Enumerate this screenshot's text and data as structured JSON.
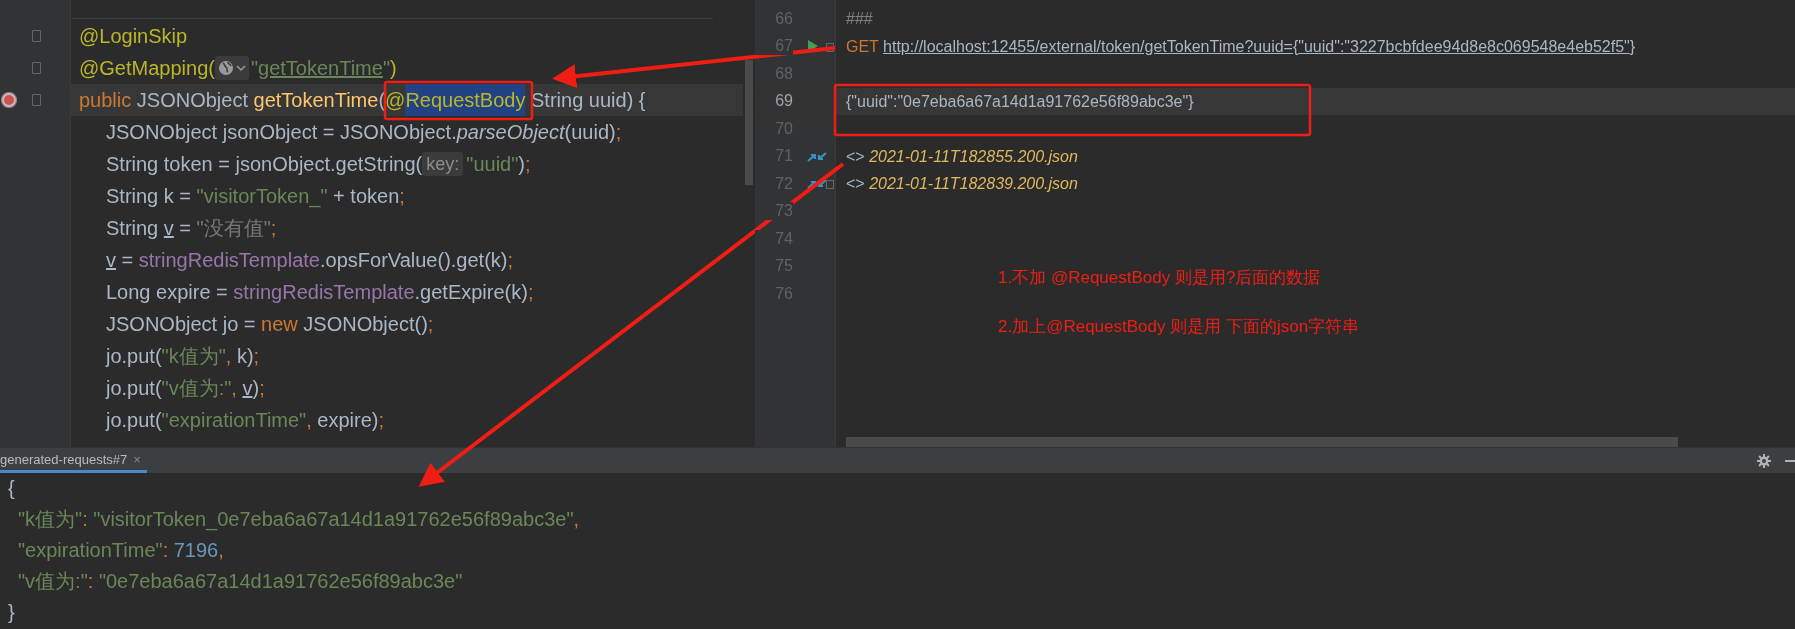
{
  "left_editor": {
    "lines": [
      {
        "fold": true,
        "override": false,
        "current": false,
        "indent": false,
        "tokens": [
          {
            "kind": "annotation",
            "text": "@LoginSkip"
          }
        ]
      },
      {
        "fold": true,
        "override": false,
        "current": false,
        "indent": false,
        "tokens": [
          {
            "kind": "annotation",
            "text": "@GetMapping("
          },
          {
            "kind": "globe-hint"
          },
          {
            "kind": "string",
            "text": "\""
          },
          {
            "kind": "url",
            "text": "getTokenTime"
          },
          {
            "kind": "string",
            "text": "\""
          },
          {
            "kind": "annotation",
            "text": ")"
          }
        ]
      },
      {
        "fold": true,
        "override": true,
        "current": true,
        "indent": false,
        "tokens": [
          {
            "kind": "keyword",
            "text": "public "
          },
          {
            "kind": "plain",
            "text": "JSONObject "
          },
          {
            "kind": "declaration",
            "text": "getTokenTime"
          },
          {
            "kind": "plain",
            "text": "("
          },
          {
            "kind": "annotation",
            "text": "@"
          },
          {
            "kind": "selected",
            "text": "RequestBody"
          },
          {
            "kind": "plain",
            "text": " String uuid) {"
          }
        ]
      },
      {
        "fold": false,
        "override": false,
        "current": false,
        "indent": true,
        "tokens": [
          {
            "kind": "plain",
            "text": "JSONObject jsonObject = JSONObject."
          },
          {
            "kind": "method",
            "text": "parseObject"
          },
          {
            "kind": "plain",
            "text": "(uuid)"
          },
          {
            "kind": "punct",
            "text": ";"
          }
        ]
      },
      {
        "fold": false,
        "override": false,
        "current": false,
        "indent": true,
        "tokens": [
          {
            "kind": "plain",
            "text": "String token = jsonObject.getString("
          },
          {
            "kind": "hint",
            "text": "key:"
          },
          {
            "kind": "string",
            "text": "\"uuid\""
          },
          {
            "kind": "plain",
            "text": ")"
          },
          {
            "kind": "punct",
            "text": ";"
          }
        ]
      },
      {
        "fold": false,
        "override": false,
        "current": false,
        "indent": true,
        "tokens": [
          {
            "kind": "plain",
            "text": "String k = "
          },
          {
            "kind": "string",
            "text": "\"visitorToken_\""
          },
          {
            "kind": "plain",
            "text": " + token"
          },
          {
            "kind": "punct",
            "text": ";"
          }
        ]
      },
      {
        "fold": false,
        "override": false,
        "current": false,
        "indent": true,
        "tokens": [
          {
            "kind": "plain",
            "text": "String "
          },
          {
            "kind": "var",
            "text": "v"
          },
          {
            "kind": "plain",
            "text": " = "
          },
          {
            "kind": "unused",
            "text": "\"没有值\""
          },
          {
            "kind": "punct",
            "text": ";"
          }
        ]
      },
      {
        "fold": false,
        "override": false,
        "current": false,
        "indent": true,
        "tokens": [
          {
            "kind": "var",
            "text": "v"
          },
          {
            "kind": "plain",
            "text": " = "
          },
          {
            "kind": "field",
            "text": "stringRedisTemplate"
          },
          {
            "kind": "plain",
            "text": ".opsForValue().get(k)"
          },
          {
            "kind": "punct",
            "text": ";"
          }
        ]
      },
      {
        "fold": false,
        "override": false,
        "current": false,
        "indent": true,
        "tokens": [
          {
            "kind": "plain",
            "text": "Long expire = "
          },
          {
            "kind": "field",
            "text": "stringRedisTemplate"
          },
          {
            "kind": "plain",
            "text": ".getExpire(k)"
          },
          {
            "kind": "punct",
            "text": ";"
          }
        ]
      },
      {
        "fold": false,
        "override": false,
        "current": false,
        "indent": true,
        "tokens": [
          {
            "kind": "plain",
            "text": "JSONObject jo = "
          },
          {
            "kind": "keyword",
            "text": "new"
          },
          {
            "kind": "plain",
            "text": " JSONObject()"
          },
          {
            "kind": "punct",
            "text": ";"
          }
        ]
      },
      {
        "fold": false,
        "override": false,
        "current": false,
        "indent": true,
        "tokens": [
          {
            "kind": "plain",
            "text": "jo.put("
          },
          {
            "kind": "string",
            "text": "\"k值为\""
          },
          {
            "kind": "punct",
            "text": ","
          },
          {
            "kind": "plain",
            "text": " k)"
          },
          {
            "kind": "punct",
            "text": ";"
          }
        ]
      },
      {
        "fold": false,
        "override": false,
        "current": false,
        "indent": true,
        "tokens": [
          {
            "kind": "plain",
            "text": "jo.put("
          },
          {
            "kind": "string",
            "text": "\"v值为:\""
          },
          {
            "kind": "punct",
            "text": ", "
          },
          {
            "kind": "var",
            "text": "v"
          },
          {
            "kind": "plain",
            "text": ")"
          },
          {
            "kind": "punct",
            "text": ";"
          }
        ]
      },
      {
        "fold": false,
        "override": false,
        "current": false,
        "indent": true,
        "tokens": [
          {
            "kind": "plain",
            "text": "jo.put("
          },
          {
            "kind": "string",
            "text": "\"expirationTime\""
          },
          {
            "kind": "punct",
            "text": ","
          },
          {
            "kind": "plain",
            "text": " expire)"
          },
          {
            "kind": "punct",
            "text": ";"
          }
        ]
      }
    ]
  },
  "right_editor": {
    "lines": [
      {
        "number": "66",
        "kind": "plain",
        "fold": false,
        "current": false,
        "tokens": [
          {
            "kind": "comment",
            "text": "###"
          }
        ]
      },
      {
        "number": "67",
        "kind": "run",
        "fold": true,
        "current": false,
        "tokens": [
          {
            "kind": "keyword",
            "text": "GET "
          },
          {
            "kind": "link",
            "text": "http://localhost:12455/external/token/getTokenTime?uuid={\"uuid\":\"3227bcbfdee94d8e8c069548e4eb52f5\"}"
          }
        ]
      },
      {
        "number": "68",
        "kind": "plain",
        "fold": false,
        "current": false
      },
      {
        "number": "69",
        "kind": "plain",
        "fold": false,
        "current": true,
        "tokens": [
          {
            "kind": "plain",
            "text": "{\"uuid\":\"0e7eba6a67a14d1a91762e56f89abc3e\"}"
          }
        ]
      },
      {
        "number": "70",
        "kind": "plain",
        "fold": false,
        "current": false
      },
      {
        "number": "71",
        "kind": "request",
        "fold": false,
        "current": false,
        "tokens": [
          {
            "kind": "plain",
            "text": "<> "
          },
          {
            "kind": "file",
            "text": "2021-01-11T182855.200.json"
          }
        ]
      },
      {
        "number": "72",
        "kind": "request",
        "fold": true,
        "current": false,
        "tokens": [
          {
            "kind": "plain",
            "text": "<> "
          },
          {
            "kind": "file",
            "text": "2021-01-11T182839.200.json"
          }
        ]
      },
      {
        "number": "73",
        "kind": "plain",
        "fold": false,
        "current": false
      },
      {
        "number": "74",
        "kind": "plain",
        "fold": false,
        "current": false
      },
      {
        "number": "75",
        "kind": "plain",
        "fold": false,
        "current": false
      },
      {
        "number": "76",
        "kind": "plain",
        "fold": false,
        "current": false
      }
    ],
    "notes": [
      "1.不加 @RequestBody 则是用?后面的数据",
      "2.加上@RequestBody 则是用 下面的json字符串"
    ]
  },
  "output_panel": {
    "tab": "generated-requests#7",
    "close": "×",
    "lines": [
      [
        {
          "kind": "plain",
          "text": "{"
        }
      ],
      [
        {
          "kind": "string",
          "text": "\"k值为\""
        },
        {
          "kind": "punct",
          "text": ": "
        },
        {
          "kind": "string",
          "text": "\"visitorToken_0e7eba6a67a14d1a91762e56f89abc3e\""
        },
        {
          "kind": "punct",
          "text": ","
        }
      ],
      [
        {
          "kind": "string",
          "text": "\"expirationTime\""
        },
        {
          "kind": "punct",
          "text": ": "
        },
        {
          "kind": "number",
          "text": "7196"
        },
        {
          "kind": "punct",
          "text": ","
        }
      ],
      [
        {
          "kind": "string",
          "text": "\"v值为:\""
        },
        {
          "kind": "punct",
          "text": ": "
        },
        {
          "kind": "string",
          "text": "\"0e7eba6a67a14d1a91762e56f89abc3e\""
        }
      ],
      [
        {
          "kind": "plain",
          "text": "}"
        }
      ]
    ]
  }
}
